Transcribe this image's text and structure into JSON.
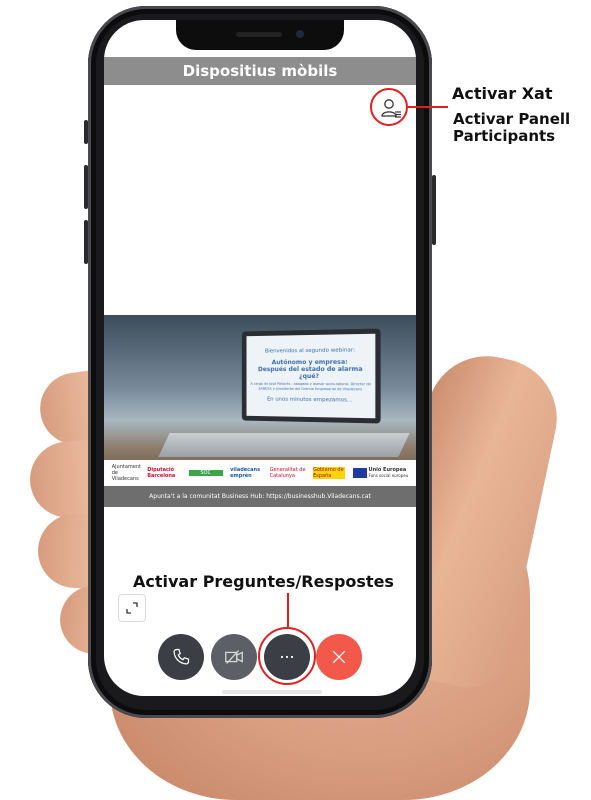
{
  "app": {
    "title": "Dispositius mòbils"
  },
  "annotations": {
    "chat": "Activar Xat",
    "participants_line1": "Activar Panell",
    "participants_line2": "Participants",
    "qa": "Activar Preguntes/Respostes"
  },
  "slide": {
    "line1": "Bienvenidos al segundo webinar:",
    "line2": "Autónomo y empresa:",
    "line3": "Después del estado de alarma ¿qué?",
    "line4": "A cargo de José Pallarés - abogado y asesor socio-laboral. Director de SABESA y presidente del Gremio Empresarial de Viladecans",
    "line5": "En unos minutos empezamos…",
    "logos": [
      "Ajuntament de Viladecans",
      "Diputació Barcelona",
      "SOC",
      "viladecans emprèn",
      "Generalitat de Catalunya",
      "Gobierno de España",
      "Unió Europea Fons social europeu"
    ],
    "logo_eu_title": "Unió Europea",
    "logo_eu_sub": "Fons social europeu",
    "footer": "Apunta't a la comunitat Business Hub: https://businesshub.Viladecans.cat"
  },
  "controls": {
    "call": "phone-icon",
    "video": "video-off-icon",
    "more": "more-icon",
    "hangup": "close-icon"
  },
  "colors": {
    "title_bar": "#8d8d8d",
    "dark_button": "#3b3f45",
    "video_button": "#5c6066",
    "hangup_button": "#f2594b",
    "highlight": "#e02020"
  }
}
